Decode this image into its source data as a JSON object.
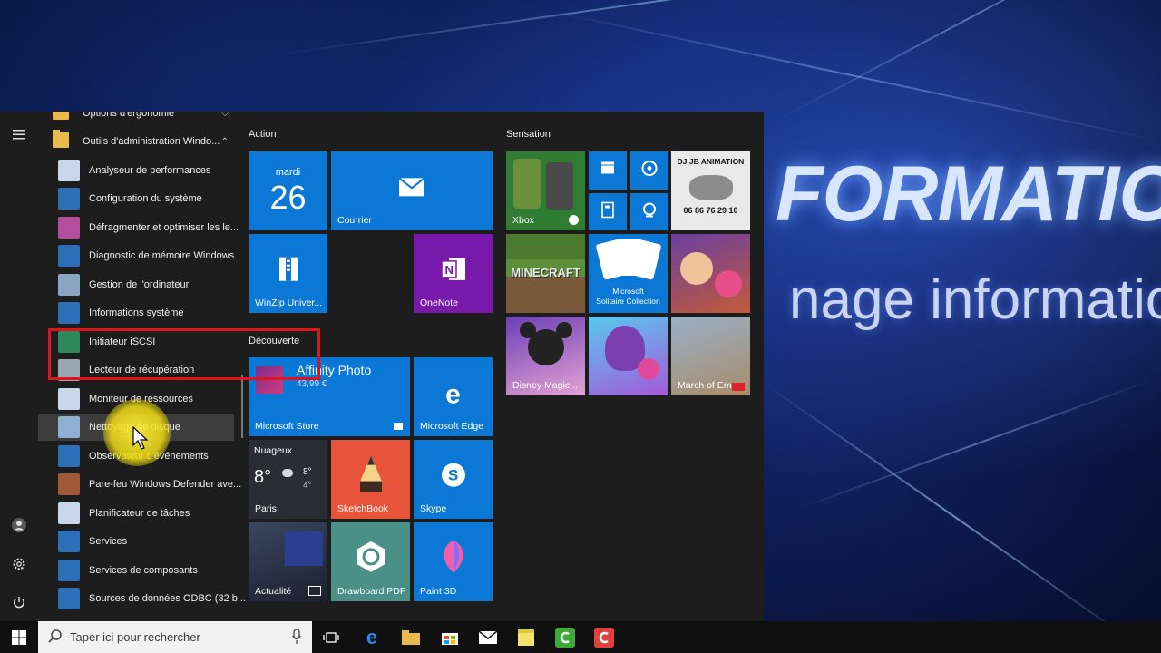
{
  "desktop": {
    "line1": "FORMATIO",
    "line2": "nage informatio"
  },
  "rail": {
    "menu_icon": "hamburger-icon",
    "user_icon": "user-icon",
    "settings_icon": "gear-icon",
    "power_icon": "power-icon"
  },
  "applist": {
    "items": [
      {
        "label": "Options d'ergonomie",
        "type": "folder"
      },
      {
        "label": "Outils d'administration Windo...",
        "type": "folder"
      },
      {
        "label": "Analyseur de performances"
      },
      {
        "label": "Configuration du système"
      },
      {
        "label": "Défragmenter et optimiser les le..."
      },
      {
        "label": "Diagnostic de mémoire Windows"
      },
      {
        "label": "Gestion de l'ordinateur"
      },
      {
        "label": "Informations système"
      },
      {
        "label": "Initiateur iSCSI"
      },
      {
        "label": "Lecteur de récupération"
      },
      {
        "label": "Moniteur de ressources"
      },
      {
        "label": "Nettoyage de disque"
      },
      {
        "label": "Observateur d'événements"
      },
      {
        "label": "Pare-feu Windows Defender ave..."
      },
      {
        "label": "Planificateur de tâches"
      },
      {
        "label": "Services"
      },
      {
        "label": "Services de composants"
      },
      {
        "label": "Sources de données ODBC (32 b..."
      }
    ]
  },
  "groups": {
    "action": "Action",
    "decouverte": "Découverte",
    "sensation": "Sensation"
  },
  "tiles": {
    "calendar": {
      "day": "mardi",
      "date": "26"
    },
    "courrier": "Courrier",
    "winzip": "WinZip Univer...",
    "onenote": "OneNote",
    "store": {
      "app": "Affinity Photo",
      "price": "43,99 €",
      "label": "Microsoft Store"
    },
    "edge": "Microsoft Edge",
    "weather": {
      "cond": "Nuageux",
      "temp": "8°",
      "hi": "8°",
      "lo": "4°",
      "city": "Paris"
    },
    "sketchbook": "SketchBook",
    "skype": "Skype",
    "actualite": "Actualité",
    "drawboard": "Drawboard PDF",
    "paint3d": "Paint 3D",
    "xbox": "Xbox",
    "dj": {
      "line1": "DJ JB ANIMATION",
      "phone": "06 86 76 29 10"
    },
    "minecraft": "MINECRAFT",
    "solitaire": {
      "line1": "Microsoft",
      "line2": "Solitaire Collection"
    },
    "disney": "Disney Magic...",
    "march": "March of Em..."
  },
  "taskbar": {
    "search_placeholder": "Taper ici pour rechercher"
  },
  "colors": {
    "tile_blue": "#0a78d4",
    "onenote": "#7719aa",
    "highlight": "#e0141e"
  }
}
